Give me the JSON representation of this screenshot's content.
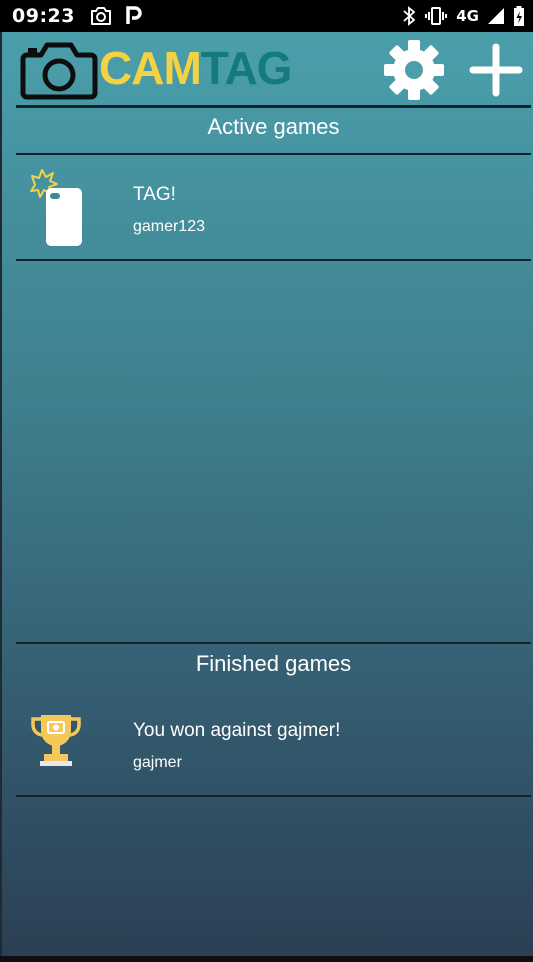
{
  "status_bar": {
    "time": "09:23",
    "left_icons": [
      "camera-icon",
      "parking-icon"
    ],
    "network": "4G",
    "right_icons": [
      "bluetooth-icon",
      "vibrate-icon",
      "signal-icon",
      "battery-charging-icon"
    ]
  },
  "header": {
    "logo_cam": "CAM",
    "logo_tag": "TAG",
    "settings_icon": "gear-icon",
    "add_icon": "plus-icon"
  },
  "active": {
    "title": "Active games",
    "games": [
      {
        "title": "TAG!",
        "player": "gamer123",
        "icon": "phone-flash-icon"
      }
    ]
  },
  "finished": {
    "title": "Finished games",
    "games": [
      {
        "title": "You won against gajmer!",
        "player": "gajmer",
        "icon": "trophy-icon"
      }
    ]
  },
  "colors": {
    "logo_cam": "#f5d244",
    "logo_tag": "#137b7b",
    "gradient_top": "#4a9fab",
    "gradient_bottom": "#2c3f53"
  }
}
